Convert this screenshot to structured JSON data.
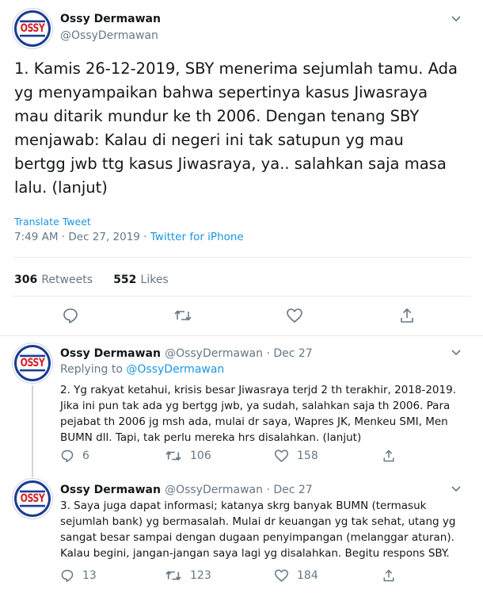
{
  "main_tweet": {
    "author_name": "Ossy Dermawan",
    "author_handle": "@OssyDermawan",
    "avatar_text": "OSSY",
    "text": "1. Kamis 26-12-2019, SBY menerima sejumlah tamu. Ada yg menyampaikan bahwa sepertinya kasus Jiwasraya mau ditarik mundur ke th 2006. Dengan tenang SBY menjawab: Kalau di negeri ini tak satupun yg mau bertgg jwb ttg kasus Jiwasraya, ya.. salahkan saja masa lalu. (lanjut)",
    "translate_label": "Translate Tweet",
    "timestamp": "7:49 AM · Dec 27, 2019 · ",
    "source": "Twitter for iPhone",
    "retweets_count": "306",
    "retweets_label": "Retweets",
    "likes_count": "552",
    "likes_label": "Likes"
  },
  "replies": [
    {
      "author_name": "Ossy Dermawan",
      "author_handle": "@OssyDermawan · Dec 27",
      "avatar_text": "OSSY",
      "replying_prefix": "Replying to ",
      "replying_handle": "@OssyDermawan",
      "text": "2. Yg rakyat ketahui, krisis besar Jiwasraya terjd 2 th terakhir, 2018-2019. Jika ini pun tak ada yg bertgg jwb, ya sudah, salahkan saja th 2006. Para pejabat th 2006 jg msh ada, mulai dr saya, Wapres JK, Menkeu SMI, Men BUMN dll. Tapi, tak perlu mereka hrs disalahkan. (lanjut)",
      "reply_count": "6",
      "retweet_count": "106",
      "like_count": "158"
    },
    {
      "author_name": "Ossy Dermawan",
      "author_handle": "@OssyDermawan · Dec 27",
      "avatar_text": "OSSY",
      "text": "3. Saya juga dapat informasi; katanya skrg banyak BUMN (termasuk sejumlah bank) yg bermasalah. Mulai dr keuangan yg tak sehat, utang yg sangat besar sampai dengan dugaan penyimpangan (melanggar aturan). Kalau begini, jangan-jangan saya lagi yg disalahkan. Begitu respons SBY.",
      "reply_count": "13",
      "retweet_count": "123",
      "like_count": "184"
    }
  ],
  "colors": {
    "link": "#1b95e0",
    "secondary_text": "#657786",
    "divider": "#e6ecf0",
    "avatar_blue": "#1a3d93",
    "avatar_red": "#d71f27"
  },
  "icons": [
    "chevron-down-icon",
    "reply-icon",
    "retweet-icon",
    "like-icon",
    "share-icon"
  ]
}
